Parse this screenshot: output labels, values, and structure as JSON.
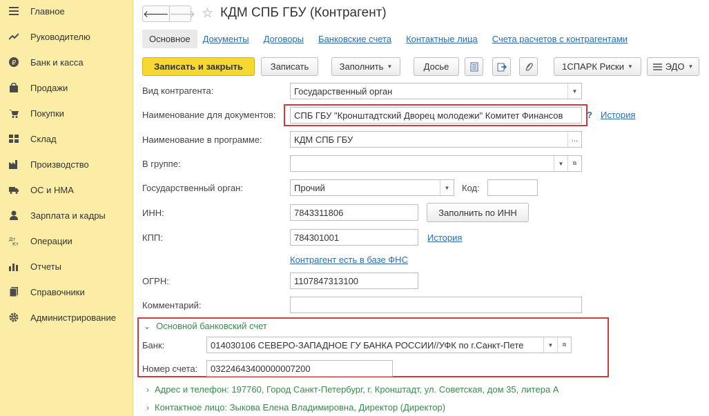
{
  "sidebar": {
    "items": [
      {
        "label": "Главное",
        "icon": "menu-icon"
      },
      {
        "label": "Руководителю",
        "icon": "trend-icon"
      },
      {
        "label": "Банк и касса",
        "icon": "ruble-icon"
      },
      {
        "label": "Продажи",
        "icon": "bag-icon"
      },
      {
        "label": "Покупки",
        "icon": "cart-icon"
      },
      {
        "label": "Склад",
        "icon": "warehouse-icon"
      },
      {
        "label": "Производство",
        "icon": "factory-icon"
      },
      {
        "label": "ОС и НМА",
        "icon": "truck-icon"
      },
      {
        "label": "Зарплата и кадры",
        "icon": "person-icon"
      },
      {
        "label": "Операции",
        "icon": "dt-kt-icon"
      },
      {
        "label": "Отчеты",
        "icon": "bar-chart-icon"
      },
      {
        "label": "Справочники",
        "icon": "books-icon"
      },
      {
        "label": "Администрирование",
        "icon": "gear-icon"
      }
    ]
  },
  "header": {
    "back": "🡐",
    "forward": "🡒",
    "star": "☆",
    "title": "КДМ СПБ ГБУ (Контрагент)"
  },
  "tabs": [
    "Основное",
    "Документы",
    "Договоры",
    "Банковские счета",
    "Контактные лица",
    "Счета расчетов с контрагентами"
  ],
  "toolbar": {
    "save_close": "Записать и закрыть",
    "save": "Записать",
    "fill": "Заполнить",
    "dossier": "Досье",
    "spark": "1СПАРК Риски",
    "edo": "ЭДО"
  },
  "form": {
    "type_label": "Вид контрагента:",
    "type_value": "Государственный орган",
    "docname_label": "Наименование для документов:",
    "docname_value": "СПБ ГБУ \"Кронштадтский Дворец молодежи\" Комитет Финансов",
    "history": "История",
    "progname_label": "Наименование в программе:",
    "progname_value": "КДМ СПБ ГБУ",
    "group_label": "В группе:",
    "group_value": "",
    "gov_label": "Государственный орган:",
    "gov_value": "Прочий",
    "code_label": "Код:",
    "code_value": "",
    "inn_label": "ИНН:",
    "inn_value": "7843311806",
    "fill_inn": "Заполнить по ИНН",
    "kpp_label": "КПП:",
    "kpp_value": "784301001",
    "kpp_history": "История",
    "fns_link": "Контрагент есть в базе ФНС",
    "ogrn_label": "ОГРН:",
    "ogrn_value": "1107847313100",
    "comment_label": "Комментарий:",
    "comment_value": ""
  },
  "bank": {
    "section": "Основной банковский счет",
    "bank_label": "Банк:",
    "bank_value": "014030106 СЕВЕРО-ЗАПАДНОЕ ГУ БАНКА РОССИИ//УФК по г.Санкт-Пете",
    "account_label": "Номер счета:",
    "account_value": "03224643400000007200"
  },
  "sections": {
    "address": "Адрес и телефон: 197760, Город Санкт-Петербург, г. Кронштадт, ул. Советская, дом 35, литера А",
    "contact": "Контактное лицо: Зыкова Елена Владимировна, Директор (Директор)"
  },
  "colors": {
    "sidebar": "#fbeda6",
    "primary_button": "#f7d831",
    "link": "#2a6db5",
    "highlight": "#d23a3a",
    "section_text": "#3a8a4c"
  }
}
